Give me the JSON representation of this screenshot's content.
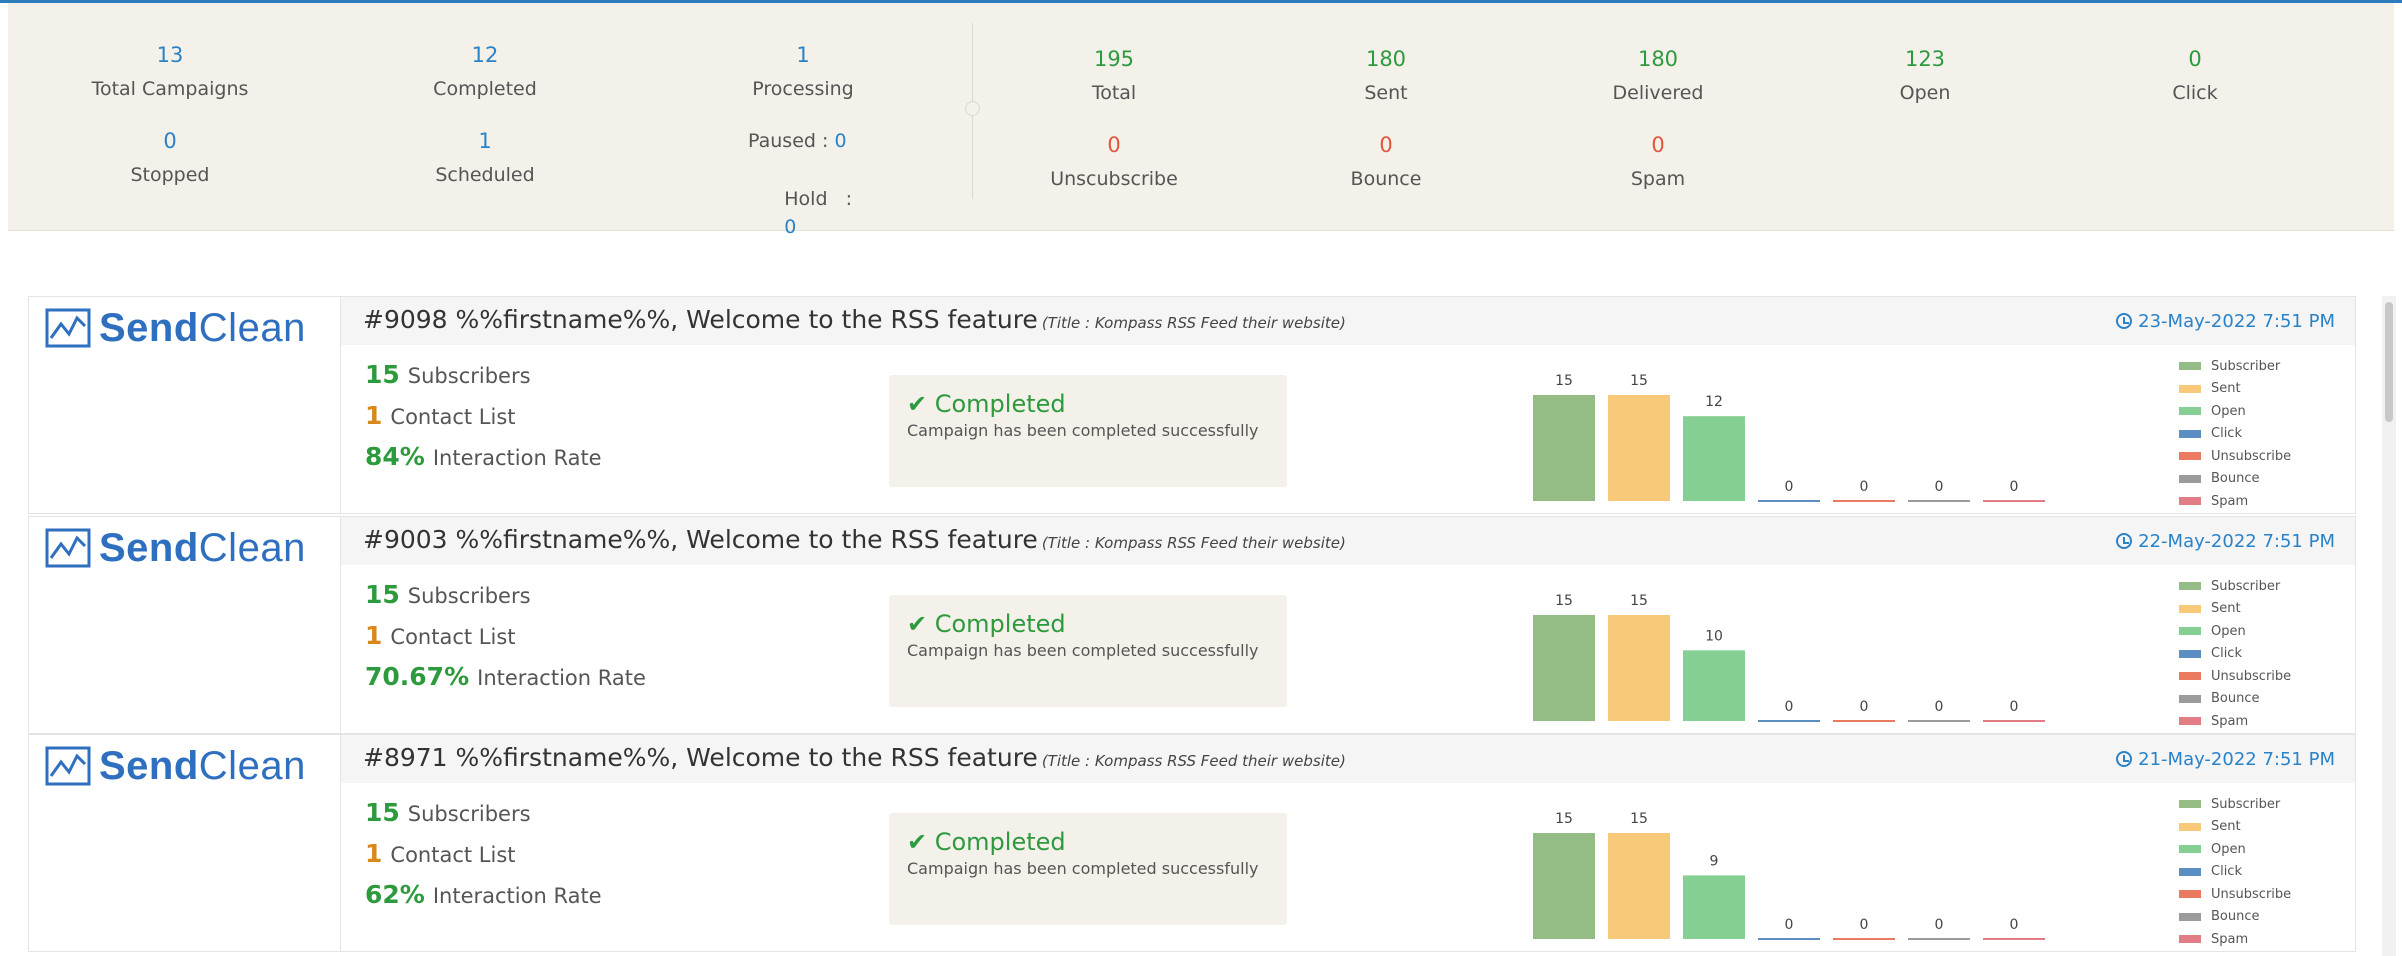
{
  "stats": {
    "total_campaigns": {
      "value": "13",
      "label": "Total Campaigns"
    },
    "completed": {
      "value": "12",
      "label": "Completed"
    },
    "processing": {
      "value": "1",
      "label": "Processing"
    },
    "stopped": {
      "value": "0",
      "label": "Stopped"
    },
    "scheduled": {
      "value": "1",
      "label": "Scheduled"
    },
    "paused": {
      "label": "Paused :",
      "value": "0"
    },
    "hold": {
      "label": "Hold   :",
      "value": "0"
    },
    "total": {
      "value": "195",
      "label": "Total"
    },
    "sent": {
      "value": "180",
      "label": "Sent"
    },
    "delivered": {
      "value": "180",
      "label": "Delivered"
    },
    "open": {
      "value": "123",
      "label": "Open"
    },
    "click": {
      "value": "0",
      "label": "Click"
    },
    "unsubscribe": {
      "value": "0",
      "label": "Unscubscribe"
    },
    "bounce": {
      "value": "0",
      "label": "Bounce"
    },
    "spam": {
      "value": "0",
      "label": "Spam"
    }
  },
  "colors": {
    "subscriber": "#93bd85",
    "sent": "#f8c978",
    "open": "#86cf93",
    "click": "#5b8fc4",
    "unsubscribe": "#ea7b60",
    "bounce": "#9b9b9b",
    "spam": "#e27d86"
  },
  "legend": [
    "Subscriber",
    "Sent",
    "Open",
    "Click",
    "Unsubscribe",
    "Bounce",
    "Spam"
  ],
  "logo": {
    "part1": "Send",
    "part2": "Clean"
  },
  "labels": {
    "subscribers": "Subscribers",
    "contact_list": "Contact List",
    "interaction_rate": "Interaction Rate",
    "status": "✔ Completed",
    "status_desc": "Campaign has been completed successfully"
  },
  "campaigns": [
    {
      "title": "#9098  %%firstname%%, Welcome to the RSS feature",
      "subtitle": "(Title : Kompass RSS Feed their website)",
      "date": "23-May-2022 7:51 PM",
      "subscribers": "15",
      "contact_list": "1",
      "interaction_rate": "84%",
      "chart_data": {
        "type": "bar",
        "categories": [
          "Subscriber",
          "Sent",
          "Open",
          "Click",
          "Unsubscribe",
          "Bounce",
          "Spam"
        ],
        "values": [
          15,
          15,
          12,
          0,
          0,
          0,
          0
        ]
      }
    },
    {
      "title": "#9003  %%firstname%%, Welcome to the RSS feature",
      "subtitle": "(Title : Kompass RSS Feed their website)",
      "date": "22-May-2022 7:51 PM",
      "subscribers": "15",
      "contact_list": "1",
      "interaction_rate": "70.67%",
      "chart_data": {
        "type": "bar",
        "categories": [
          "Subscriber",
          "Sent",
          "Open",
          "Click",
          "Unsubscribe",
          "Bounce",
          "Spam"
        ],
        "values": [
          15,
          15,
          10,
          0,
          0,
          0,
          0
        ]
      }
    },
    {
      "title": "#8971  %%firstname%%, Welcome to the RSS feature",
      "subtitle": "(Title : Kompass RSS Feed their website)",
      "date": "21-May-2022 7:51 PM",
      "subscribers": "15",
      "contact_list": "1",
      "interaction_rate": "62%",
      "chart_data": {
        "type": "bar",
        "categories": [
          "Subscriber",
          "Sent",
          "Open",
          "Click",
          "Unsubscribe",
          "Bounce",
          "Spam"
        ],
        "values": [
          15,
          15,
          9,
          0,
          0,
          0,
          0
        ]
      }
    }
  ]
}
